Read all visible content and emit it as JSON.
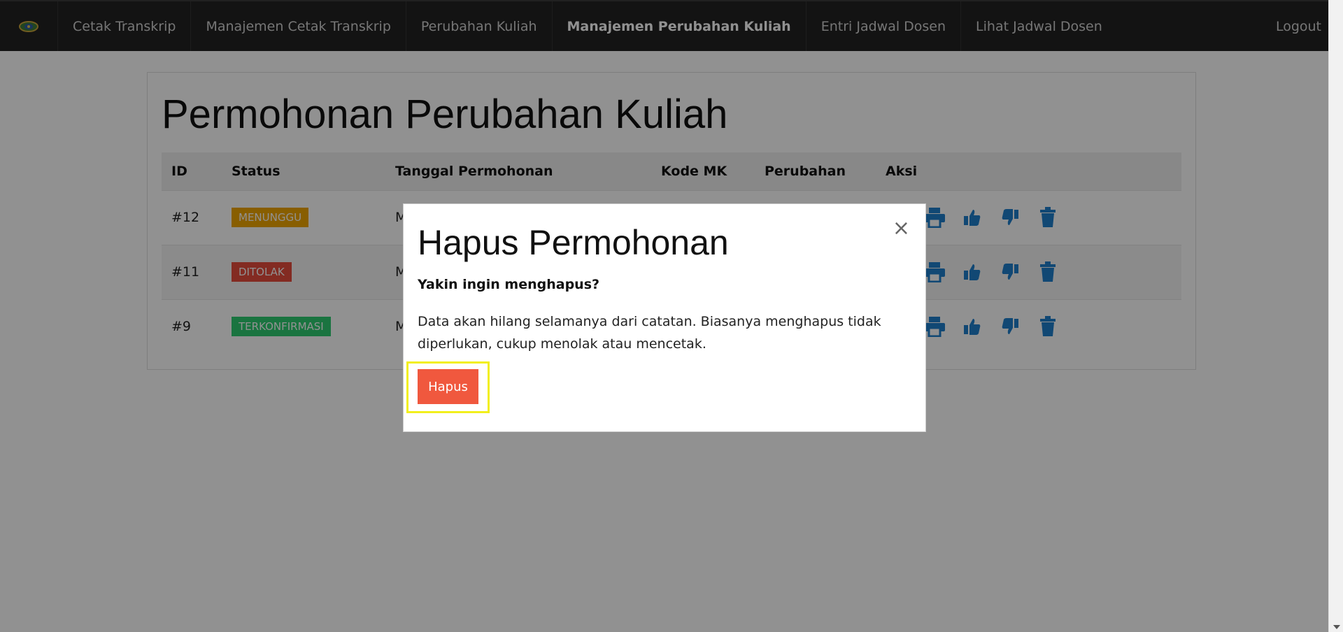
{
  "navbar": {
    "logo_icon": "university-emblem-icon",
    "items": [
      {
        "label": "Cetak Transkrip"
      },
      {
        "label": "Manajemen Cetak Transkrip"
      },
      {
        "label": "Perubahan Kuliah"
      },
      {
        "label": "Manajemen Perubahan Kuliah",
        "active": true
      },
      {
        "label": "Entri Jadwal Dosen"
      },
      {
        "label": "Lihat Jadwal Dosen"
      }
    ],
    "logout_label": "Logout"
  },
  "page": {
    "title": "Permohonan Perubahan Kuliah",
    "table": {
      "headers": [
        "ID",
        "Status",
        "Tanggal Permohonan",
        "Kode MK",
        "Perubahan",
        "Aksi"
      ],
      "rows": [
        {
          "id": "#12",
          "status": "MENUNGGU",
          "status_color": "#f0a500",
          "date_partial": "M"
        },
        {
          "id": "#11",
          "status": "DITOLAK",
          "status_color": "#e74c3c",
          "date_partial": "M"
        },
        {
          "id": "#9",
          "status": "TERKONFIRMASI",
          "status_color": "#2ecc71",
          "date_partial": "M"
        }
      ],
      "action_icons": [
        "print-icon",
        "thumbs-up-icon",
        "thumbs-down-icon",
        "trash-icon"
      ],
      "action_color": "#1f7fcc"
    }
  },
  "modal": {
    "title": "Hapus Permohonan",
    "close_glyph": "×",
    "question": "Yakin ingin menghapus?",
    "message": "Data akan hilang selamanya dari catatan. Biasanya menghapus tidak diperlukan, cukup menolak atau mencetak.",
    "confirm_label": "Hapus",
    "confirm_color": "#f0583e"
  }
}
